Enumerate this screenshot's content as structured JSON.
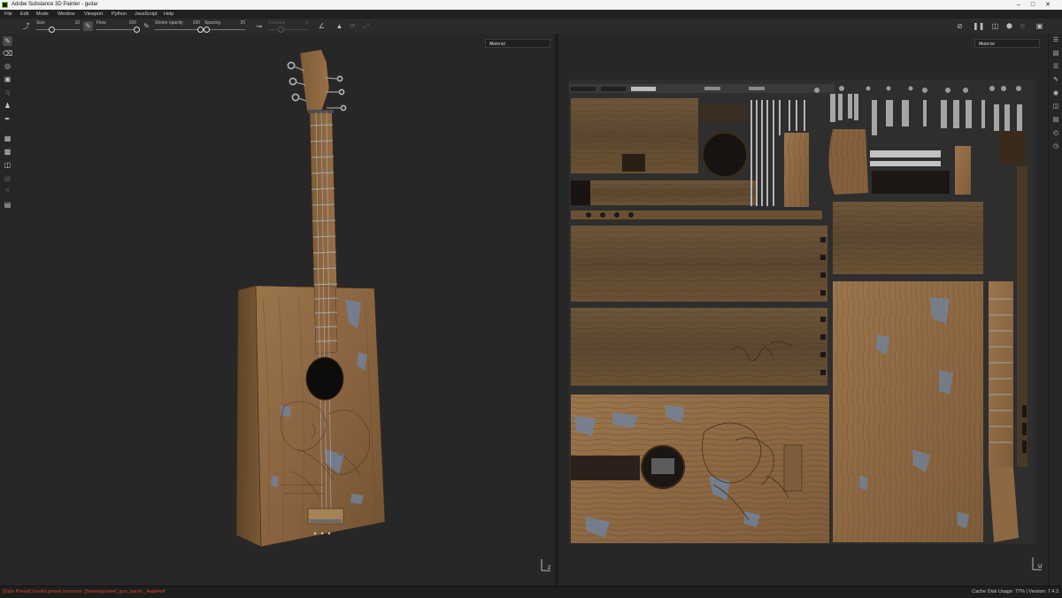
{
  "window": {
    "title": "Adobe Substance 3D Painter - guitar",
    "controls": [
      "minimize-icon",
      "maximize-icon",
      "close-icon"
    ]
  },
  "menu": [
    "File",
    "Edit",
    "Mode",
    "Window",
    "Viewport",
    "Python",
    "JavaScript",
    "Help"
  ],
  "toolbar": {
    "size": {
      "label": "Size",
      "value": "10",
      "fraction": 0.35
    },
    "flow": {
      "label": "Flow",
      "value": "100",
      "fraction": 1.0
    },
    "stroke_opacity": {
      "label": "Stroke opacity",
      "value": "100",
      "fraction": 1.0
    },
    "spacing": {
      "label": "Spacing",
      "value": "20",
      "fraction": 0.05
    },
    "distance": {
      "label": "Distance",
      "value": "8",
      "fraction": 0.3
    }
  },
  "left_tools": [
    "paint-brush-icon",
    "eraser-icon",
    "projection-icon",
    "geometry-mask-icon",
    "smudge-icon",
    "clone-icon",
    "color-picker-icon",
    "bake-tool-icon",
    "polygon-fill-icon",
    "material-picker-icon",
    "text-tool-icon",
    "clipboard-icon",
    "document-icon"
  ],
  "right_tools": [
    "texture-set-list-icon",
    "texture-set-settings-icon",
    "layers-icon",
    "properties-icon",
    "display-settings-icon",
    "shelf-icon",
    "history-icon",
    "log-icon"
  ],
  "viewport_3d": {
    "mode": "Material"
  },
  "viewport_2d": {
    "mode": "Material"
  },
  "status": {
    "message": "[Data Preset] Invalid preset resource: [Saveday/steel_gun_barrel _4ada4nif",
    "cache": "Cache Disk Usage:",
    "cache_value": "77%",
    "version": "| Version: 7.4.3"
  },
  "colors": {
    "wood": "#8f6a44",
    "wood_dark": "#5a4128",
    "paint_blue": "#6e86a6",
    "viewport_bg": "#272727",
    "error_text": "#d9432f"
  }
}
